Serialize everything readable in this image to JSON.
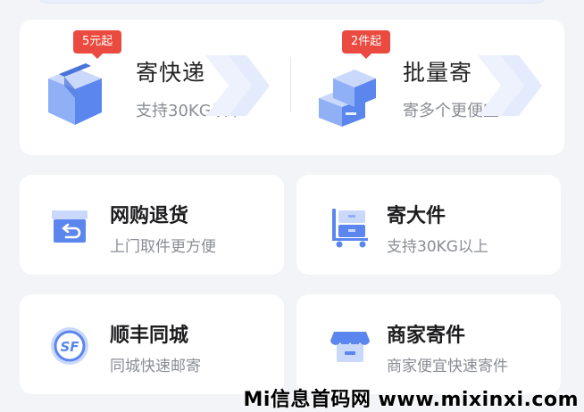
{
  "colors": {
    "background": "#f3f4f7",
    "card": "#ffffff",
    "badge": "#ea4a3f",
    "icon_blue": "#5b86ee",
    "icon_light": "#c9d8fb",
    "title": "#222222",
    "subtitle": "#8a8d94"
  },
  "hero": {
    "left": {
      "badge": "5元起",
      "title": "寄快递",
      "subtitle": "支持30KG以下",
      "icon": "package-box-icon"
    },
    "right": {
      "badge": "2件起",
      "title": "批量寄",
      "subtitle": "寄多个更便宜",
      "icon": "stacked-boxes-icon"
    }
  },
  "services": [
    {
      "title": "网购退货",
      "subtitle": "上门取件更方便",
      "icon": "return-box-icon"
    },
    {
      "title": "寄大件",
      "subtitle": "支持30KG以上",
      "icon": "cart-icon"
    },
    {
      "title": "顺丰同城",
      "subtitle": "同城快速邮寄",
      "icon": "sf-logo-icon"
    },
    {
      "title": "商家寄件",
      "subtitle": "商家便宜快速寄件",
      "icon": "shop-icon"
    }
  ],
  "watermark": "Mi信息首码网 www.mixinxi.com"
}
